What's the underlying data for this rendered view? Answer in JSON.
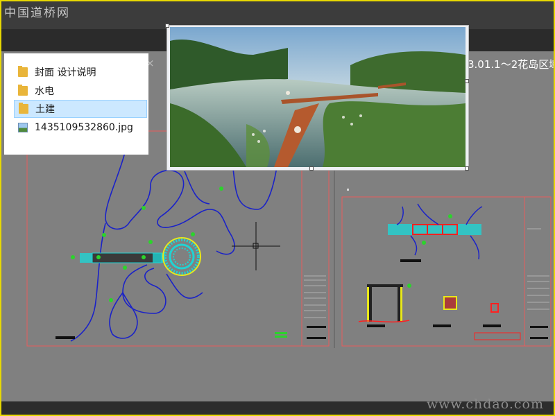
{
  "watermark_top": "中国道桥网",
  "watermark_bottom": "www.chdao.com",
  "title_tail": "3.01.1～2花岛区域",
  "tab_close_glyph": "×",
  "file_list": [
    {
      "name": "封面 设计说明",
      "icon": "folder-icon",
      "selected": false
    },
    {
      "name": "水电",
      "icon": "folder-icon",
      "selected": false
    },
    {
      "name": "土建",
      "icon": "folder-icon",
      "selected": true
    },
    {
      "name": "1435109532860.jpg",
      "icon": "image-file-icon",
      "selected": false
    }
  ],
  "colors": {
    "cad_background": "#808080",
    "frame_border": "#e8d800",
    "sheet_border": "#e85c5c",
    "curve_blue": "#1a22c8",
    "cyan": "#1fd3d3",
    "green_label": "#2bd42b",
    "selection": "#cce8ff"
  },
  "preview": {
    "content": "landscape rendering: river with wooden boardwalk bridge"
  }
}
